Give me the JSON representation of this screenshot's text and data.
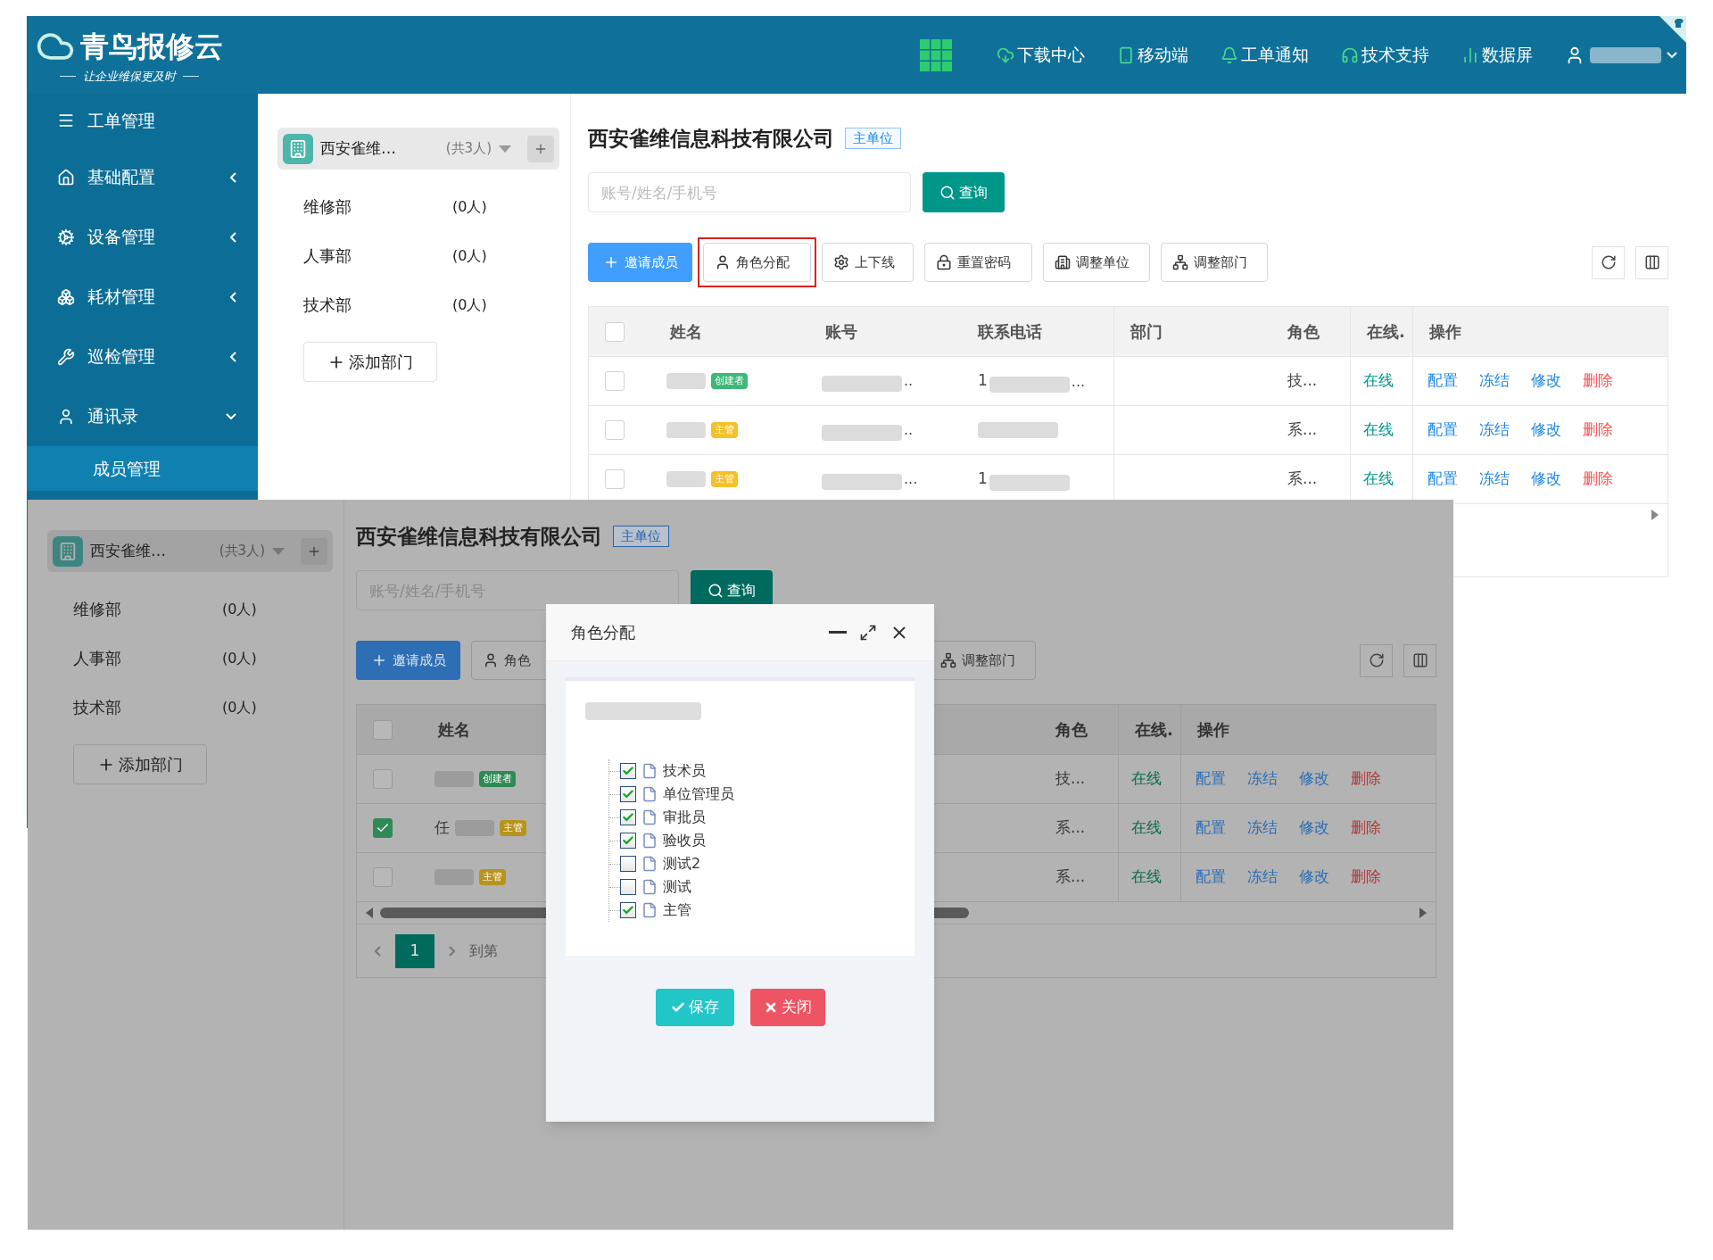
{
  "header": {
    "logo_title": "青鸟报修云",
    "logo_slogan": "让企业维保更及时",
    "nav": [
      "下载中心",
      "移动端",
      "工单通知",
      "技术支持",
      "数据屏"
    ]
  },
  "sidebar": {
    "items": [
      {
        "label": "工单管理",
        "kind": "link"
      },
      {
        "label": "基础配置",
        "kind": "group",
        "expanded": false
      },
      {
        "label": "设备管理",
        "kind": "group",
        "expanded": false
      },
      {
        "label": "耗材管理",
        "kind": "group",
        "expanded": false
      },
      {
        "label": "巡检管理",
        "kind": "group",
        "expanded": false
      },
      {
        "label": "通讯录",
        "kind": "group",
        "expanded": true,
        "children": [
          {
            "label": "成员管理",
            "selected": true
          }
        ]
      }
    ]
  },
  "upper": {
    "org": {
      "name": "西安雀维…",
      "count": "(共3人)"
    },
    "departments": [
      {
        "name": "维修部",
        "count": "(0人)"
      },
      {
        "name": "人事部",
        "count": "(0人)"
      },
      {
        "name": "技术部",
        "count": "(0人)"
      }
    ],
    "add_department": "添加部门",
    "company": {
      "title": "西安雀维信息科技有限公司",
      "badge": "主单位"
    },
    "search": {
      "placeholder": "账号/姓名/手机号",
      "button": "查询"
    },
    "toolbar": [
      {
        "kind": "invite",
        "label": "邀请成员",
        "highlighted": false
      },
      {
        "kind": "roles",
        "label": "角色分配",
        "highlighted": true
      },
      {
        "kind": "toggle",
        "label": "上下线",
        "highlighted": false
      },
      {
        "kind": "reset",
        "label": "重置密码",
        "highlighted": false
      },
      {
        "kind": "unit",
        "label": "调整单位",
        "highlighted": false
      },
      {
        "kind": "dept",
        "label": "调整部门",
        "highlighted": false
      }
    ],
    "table": {
      "all_checked": false,
      "columns": [
        {
          "kind": "name",
          "label": "姓名"
        },
        {
          "kind": "account",
          "label": "账号"
        },
        {
          "kind": "phone",
          "label": "联系电话"
        },
        {
          "kind": "dept",
          "label": "部门"
        },
        {
          "kind": "role",
          "label": "角色"
        },
        {
          "kind": "online",
          "label": "在线."
        },
        {
          "kind": "actions",
          "label": "操作"
        }
      ],
      "rows": [
        {
          "checked": false,
          "badge": {
            "text": "创建者",
            "color": "#3cb878"
          },
          "account_suffix": "..",
          "phone_prefix": "1",
          "phone_suffix": "...",
          "role": "技...",
          "online": "在线",
          "actions": [
            {
              "label": "配置",
              "kind": "edit"
            },
            {
              "label": "冻结",
              "kind": "edit"
            },
            {
              "label": "修改",
              "kind": "edit"
            },
            {
              "label": "删除",
              "kind": "danger"
            }
          ]
        },
        {
          "checked": false,
          "badge": {
            "text": "主管",
            "color": "#f5c02a"
          },
          "account_suffix": "..",
          "role": "系...",
          "online": "在线",
          "actions": [
            {
              "label": "配置",
              "kind": "edit"
            },
            {
              "label": "冻结",
              "kind": "edit"
            },
            {
              "label": "修改",
              "kind": "edit"
            },
            {
              "label": "删除",
              "kind": "danger"
            }
          ]
        },
        {
          "checked": false,
          "badge": {
            "text": "主管",
            "color": "#f5c02a"
          },
          "account_suffix": "...",
          "phone_prefix": "1",
          "role": "系...",
          "online": "在线",
          "actions": [
            {
              "label": "配置",
              "kind": "edit"
            },
            {
              "label": "冻结",
              "kind": "edit"
            },
            {
              "label": "修改",
              "kind": "edit"
            },
            {
              "label": "删除",
              "kind": "danger"
            }
          ]
        }
      ]
    }
  },
  "lower": {
    "org": {
      "name": "西安雀维…",
      "count": "(共3人)"
    },
    "departments": [
      {
        "name": "维修部",
        "count": "(0人)"
      },
      {
        "name": "人事部",
        "count": "(0人)"
      },
      {
        "name": "技术部",
        "count": "(0人)"
      }
    ],
    "add_department": "添加部门",
    "company": {
      "title": "西安雀维信息科技有限公司",
      "badge": "主单位"
    },
    "search": {
      "placeholder": "账号/姓名/手机号",
      "button": "查询"
    },
    "toolbar": [
      {
        "kind": "invite",
        "label": "邀请成员",
        "highlighted": false
      },
      {
        "kind": "roles",
        "label": "角色",
        "highlighted": false
      },
      {
        "kind": "dept",
        "label": "调整部门",
        "highlighted": false
      }
    ],
    "table": {
      "all_checked": false,
      "columns": [
        {
          "kind": "name",
          "label": "姓名"
        },
        {
          "kind": "role",
          "label": "角色"
        },
        {
          "kind": "online",
          "label": "在线."
        },
        {
          "kind": "actions",
          "label": "操作"
        }
      ],
      "rows": [
        {
          "checked": false,
          "badge": {
            "text": "创建者",
            "color": "#2f8a55"
          },
          "role": "技...",
          "online": "在线",
          "actions": [
            {
              "label": "配置",
              "kind": "edit"
            },
            {
              "label": "冻结",
              "kind": "edit"
            },
            {
              "label": "修改",
              "kind": "edit"
            },
            {
              "label": "删除",
              "kind": "danger"
            }
          ]
        },
        {
          "checked": true,
          "name_prefix": "任",
          "badge": {
            "text": "主管",
            "color": "#b8941e"
          },
          "role": "系...",
          "online": "在线",
          "actions": [
            {
              "label": "配置",
              "kind": "edit"
            },
            {
              "label": "冻结",
              "kind": "edit"
            },
            {
              "label": "修改",
              "kind": "edit"
            },
            {
              "label": "删除",
              "kind": "danger"
            }
          ]
        },
        {
          "checked": false,
          "badge": {
            "text": "主管",
            "color": "#b8941e"
          },
          "role": "系...",
          "online": "在线",
          "actions": [
            {
              "label": "配置",
              "kind": "edit"
            },
            {
              "label": "冻结",
              "kind": "edit"
            },
            {
              "label": "修改",
              "kind": "edit"
            },
            {
              "label": "删除",
              "kind": "danger"
            }
          ]
        }
      ]
    },
    "pagination": {
      "pages": [
        {
          "label": "1",
          "selected": true
        }
      ],
      "goto_label": "到第"
    }
  },
  "dialog": {
    "title": "角色分配",
    "roles": [
      {
        "label": "技术员",
        "checked": true
      },
      {
        "label": "单位管理员",
        "checked": true
      },
      {
        "label": "审批员",
        "checked": true
      },
      {
        "label": "验收员",
        "checked": true
      },
      {
        "label": "测试2",
        "checked": false
      },
      {
        "label": "测试",
        "checked": false
      },
      {
        "label": "主管",
        "checked": true
      }
    ],
    "buttons": [
      {
        "label": "保存",
        "kind": "save"
      },
      {
        "label": "关闭",
        "kind": "close"
      }
    ]
  }
}
